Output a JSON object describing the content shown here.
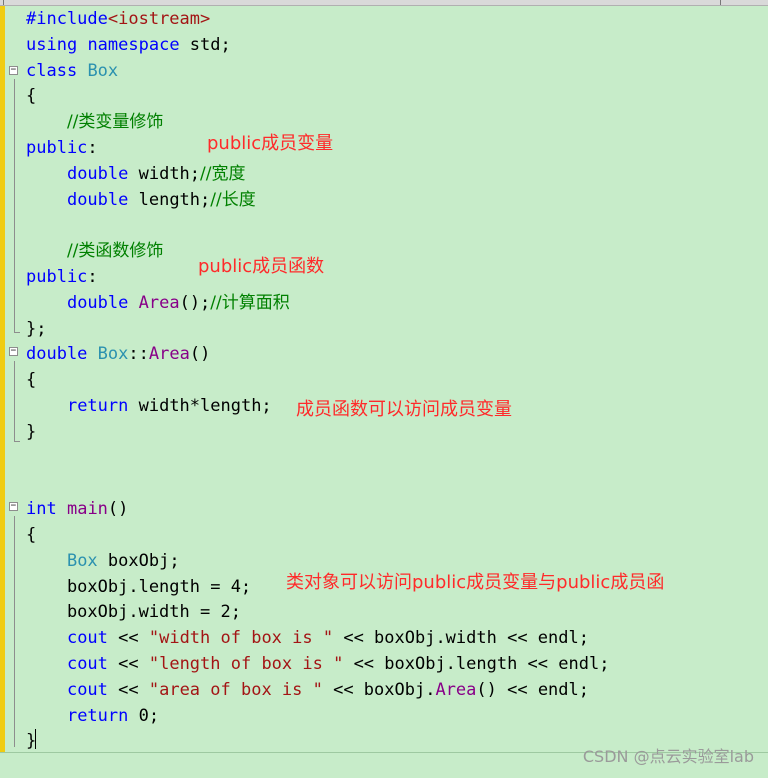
{
  "editor": {
    "lines": [
      {
        "tokens": [
          {
            "t": "#include",
            "c": "tok-kw"
          },
          {
            "t": "<iostream>",
            "c": "tok-str"
          }
        ]
      },
      {
        "tokens": [
          {
            "t": "using",
            "c": "tok-kw"
          },
          {
            "t": " "
          },
          {
            "t": "namespace",
            "c": "tok-kw"
          },
          {
            "t": " std;"
          }
        ]
      },
      {
        "tokens": [
          {
            "t": "class",
            "c": "tok-kw"
          },
          {
            "t": " "
          },
          {
            "t": "Box",
            "c": "tok-type"
          }
        ]
      },
      {
        "tokens": [
          {
            "t": "{"
          }
        ]
      },
      {
        "tokens": [
          {
            "t": "    "
          },
          {
            "t": "//类变量修饰",
            "c": "tok-cmt"
          }
        ]
      },
      {
        "tokens": [
          {
            "t": "public",
            "c": "tok-kw"
          },
          {
            "t": ":"
          }
        ]
      },
      {
        "tokens": [
          {
            "t": "    "
          },
          {
            "t": "double",
            "c": "tok-kw"
          },
          {
            "t": " width;"
          },
          {
            "t": "//宽度",
            "c": "tok-cmt"
          }
        ]
      },
      {
        "tokens": [
          {
            "t": "    "
          },
          {
            "t": "double",
            "c": "tok-kw"
          },
          {
            "t": " length;"
          },
          {
            "t": "//长度",
            "c": "tok-cmt"
          }
        ]
      },
      {
        "tokens": []
      },
      {
        "tokens": [
          {
            "t": "    "
          },
          {
            "t": "//类函数修饰",
            "c": "tok-cmt"
          }
        ]
      },
      {
        "tokens": [
          {
            "t": "public",
            "c": "tok-kw"
          },
          {
            "t": ":"
          }
        ]
      },
      {
        "tokens": [
          {
            "t": "    "
          },
          {
            "t": "double",
            "c": "tok-kw"
          },
          {
            "t": " "
          },
          {
            "t": "Area",
            "c": "tok-fn"
          },
          {
            "t": "();"
          },
          {
            "t": "//计算面积",
            "c": "tok-cmt"
          }
        ]
      },
      {
        "tokens": [
          {
            "t": "};"
          }
        ]
      },
      {
        "tokens": [
          {
            "t": "double",
            "c": "tok-kw"
          },
          {
            "t": " "
          },
          {
            "t": "Box",
            "c": "tok-type"
          },
          {
            "t": "::"
          },
          {
            "t": "Area",
            "c": "tok-fn"
          },
          {
            "t": "()"
          }
        ]
      },
      {
        "tokens": [
          {
            "t": "{"
          }
        ]
      },
      {
        "tokens": [
          {
            "t": "    "
          },
          {
            "t": "return",
            "c": "tok-kw"
          },
          {
            "t": " width*length;"
          }
        ]
      },
      {
        "tokens": [
          {
            "t": "}"
          }
        ]
      },
      {
        "tokens": []
      },
      {
        "tokens": []
      },
      {
        "tokens": [
          {
            "t": "int",
            "c": "tok-kw"
          },
          {
            "t": " "
          },
          {
            "t": "main",
            "c": "tok-fn"
          },
          {
            "t": "()"
          }
        ]
      },
      {
        "tokens": [
          {
            "t": "{"
          }
        ]
      },
      {
        "tokens": [
          {
            "t": "    "
          },
          {
            "t": "Box",
            "c": "tok-type"
          },
          {
            "t": " boxObj;"
          }
        ]
      },
      {
        "tokens": [
          {
            "t": "    boxObj.length = 4;"
          }
        ]
      },
      {
        "tokens": [
          {
            "t": "    boxObj.width = 2;"
          }
        ]
      },
      {
        "tokens": [
          {
            "t": "    "
          },
          {
            "t": "cout",
            "c": "tok-var"
          },
          {
            "t": " << "
          },
          {
            "t": "\"width of box is \"",
            "c": "tok-str"
          },
          {
            "t": " << boxObj.width << endl;"
          }
        ]
      },
      {
        "tokens": [
          {
            "t": "    "
          },
          {
            "t": "cout",
            "c": "tok-var"
          },
          {
            "t": " << "
          },
          {
            "t": "\"length of box is \"",
            "c": "tok-str"
          },
          {
            "t": " << boxObj.length << endl;"
          }
        ]
      },
      {
        "tokens": [
          {
            "t": "    "
          },
          {
            "t": "cout",
            "c": "tok-var"
          },
          {
            "t": " << "
          },
          {
            "t": "\"area of box is \"",
            "c": "tok-str"
          },
          {
            "t": " << boxObj."
          },
          {
            "t": "Area",
            "c": "tok-fn"
          },
          {
            "t": "() << endl;"
          }
        ]
      },
      {
        "tokens": [
          {
            "t": "    "
          },
          {
            "t": "return",
            "c": "tok-kw"
          },
          {
            "t": " 0;"
          }
        ]
      },
      {
        "tokens": [
          {
            "t": "}"
          }
        ]
      }
    ]
  },
  "notes": {
    "public_members": "public成员变量",
    "public_functions": "public成员函数",
    "member_access": "成员函数可以访问成员变量",
    "object_access": "类对象可以访问public成员变量与public成员函"
  },
  "watermark": "CSDN @点云实验室lab"
}
